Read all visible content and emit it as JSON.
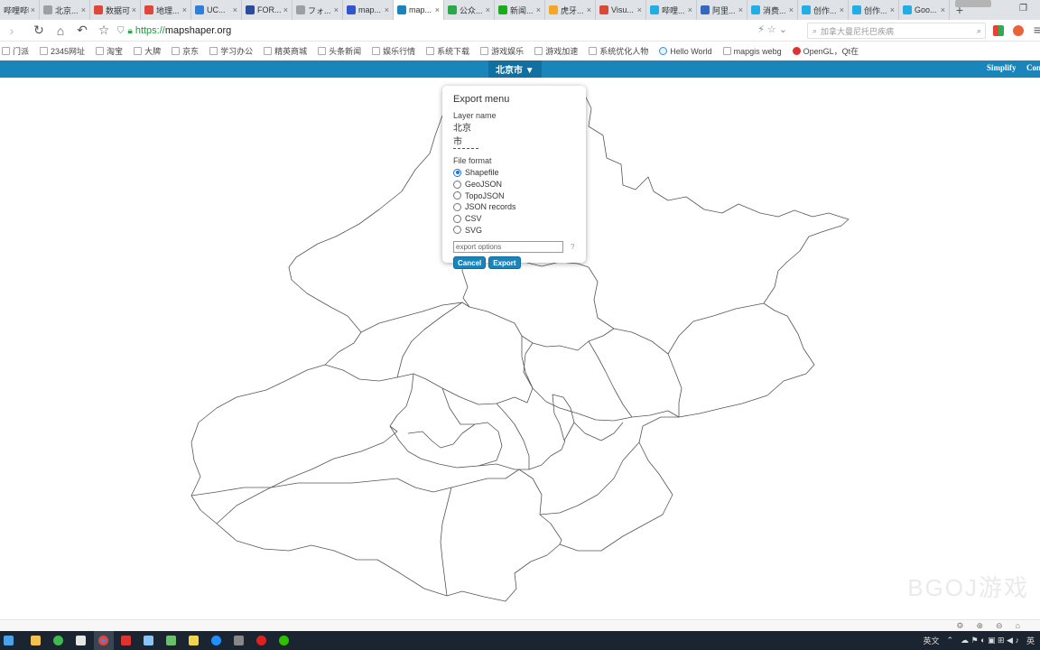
{
  "browser": {
    "tabs": [
      {
        "label": "哔哩哔哩",
        "color": "#4a90d9",
        "active": false
      },
      {
        "label": "北京...",
        "color": "#9aa0a6",
        "active": false
      },
      {
        "label": "数据可...",
        "color": "#e0473c",
        "active": false
      },
      {
        "label": "地理...",
        "color": "#e0473c",
        "active": false
      },
      {
        "label": "UC...",
        "color": "#2f7ed8",
        "active": false
      },
      {
        "label": "FOR...",
        "color": "#2a4c9a",
        "active": false
      },
      {
        "label": "フォ...",
        "color": "#9aa0a6",
        "active": false
      },
      {
        "label": "map...",
        "color": "#3355cc",
        "active": false
      },
      {
        "label": "map...",
        "color": "#1a85bb",
        "active": true
      },
      {
        "label": "公众...",
        "color": "#2aa84a",
        "active": false
      },
      {
        "label": "新闻...",
        "color": "#1aad19",
        "active": false
      },
      {
        "label": "虎牙...",
        "color": "#f5a623",
        "active": false
      },
      {
        "label": "Visu...",
        "color": "#d84a38",
        "active": false
      },
      {
        "label": "哔哩...",
        "color": "#23ade5",
        "active": false
      },
      {
        "label": "阿里...",
        "color": "#3466c2",
        "active": false
      },
      {
        "label": "消费...",
        "color": "#23ade5",
        "active": false
      },
      {
        "label": "创作...",
        "color": "#23ade5",
        "active": false
      },
      {
        "label": "创作...",
        "color": "#23ade5",
        "active": false
      },
      {
        "label": "Goo...",
        "color": "#23ade5",
        "active": false
      }
    ],
    "tab_close": "×",
    "new_tab": "+",
    "url_scheme": "https://",
    "url_host": "mapshaper.org",
    "search_placeholder": "加拿大曼尼托巴疾病",
    "bookmarks": [
      {
        "label": "门派",
        "type": "folder"
      },
      {
        "label": "2345网址",
        "type": "folder"
      },
      {
        "label": "淘宝",
        "type": "folder"
      },
      {
        "label": "大牌",
        "type": "folder"
      },
      {
        "label": "京东",
        "type": "folder"
      },
      {
        "label": "学习办公",
        "type": "folder"
      },
      {
        "label": "精英商城",
        "type": "folder"
      },
      {
        "label": "头条新闻",
        "type": "folder"
      },
      {
        "label": "娱乐行情",
        "type": "folder"
      },
      {
        "label": "系统下载",
        "type": "folder"
      },
      {
        "label": "游戏娱乐",
        "type": "folder"
      },
      {
        "label": "游戏加速",
        "type": "folder"
      },
      {
        "label": "系统优化人物",
        "type": "folder"
      },
      {
        "label": "Hello World",
        "type": "globe"
      },
      {
        "label": "mapgis webg",
        "type": "folder"
      },
      {
        "label": "OpenGL，Qt在",
        "type": "opengl"
      }
    ]
  },
  "app": {
    "layer_button": "北京市 ▼",
    "links": [
      "Simplify",
      "Con"
    ]
  },
  "export_menu": {
    "title": "Export menu",
    "layer_name_label": "Layer name",
    "layer_name_value": "北京市",
    "file_format_label": "File format",
    "formats": [
      {
        "label": "Shapefile",
        "selected": true
      },
      {
        "label": "GeoJSON",
        "selected": false
      },
      {
        "label": "TopoJSON",
        "selected": false
      },
      {
        "label": "JSON records",
        "selected": false
      },
      {
        "label": "CSV",
        "selected": false
      },
      {
        "label": "SVG",
        "selected": false
      }
    ],
    "options_placeholder": "export options",
    "help_mark": "?",
    "cancel_label": "Cancel",
    "export_label": "Export"
  },
  "watermark": "BGOJ游戏",
  "taskbar": {
    "tray_lang": "英",
    "tray_mode": "英文"
  }
}
